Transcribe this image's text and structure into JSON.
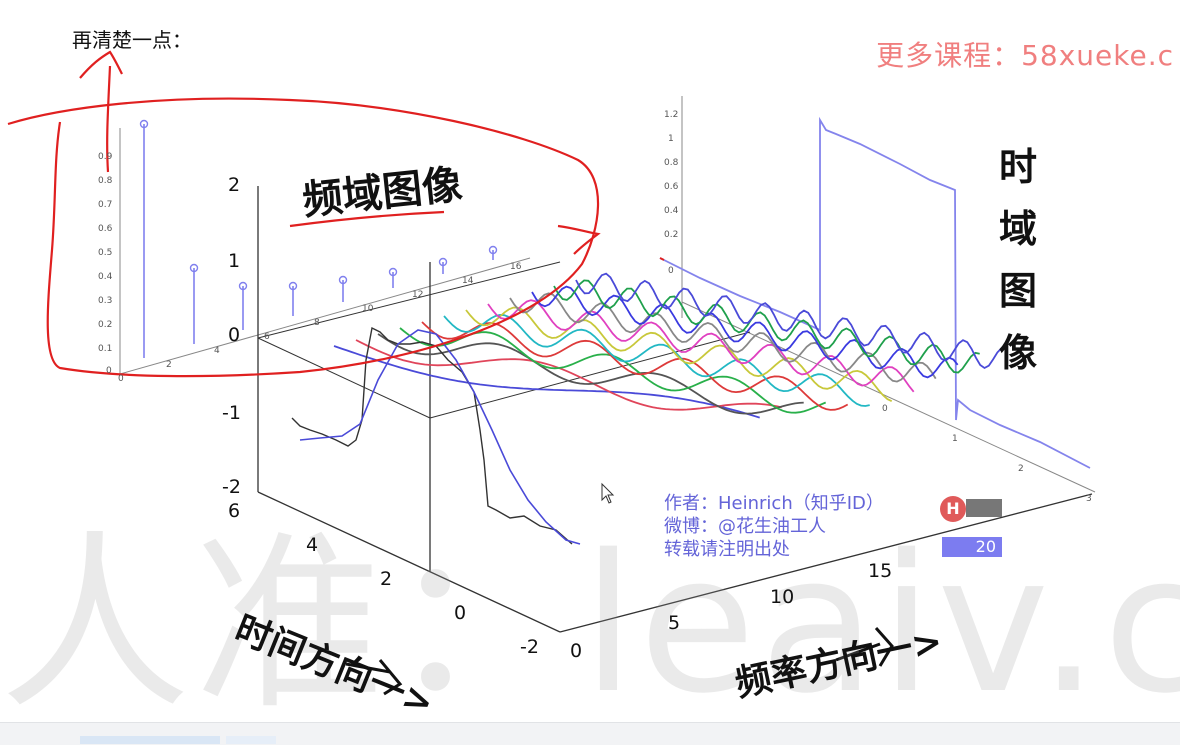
{
  "note": {
    "text": "再清楚一点："
  },
  "watermark": {
    "top_right": "更多课程：58xueke.c",
    "background": "人准：leaiv.cn"
  },
  "labels": {
    "freq_domain": "频域图像",
    "time_domain_chars": [
      "时",
      "域",
      "图",
      "像"
    ],
    "time_direction": "时间方向一>",
    "freq_direction": "频率方向一>"
  },
  "credits": {
    "author": "作者：Heinrich（知乎ID）",
    "weibo": "微博：@花生油工人",
    "repost": "转载请注明出处"
  },
  "controls": {
    "badge": "H",
    "value": "20"
  },
  "axis_ticks": {
    "vertical": [
      "2",
      "1",
      "0",
      "-1",
      "-2"
    ],
    "time": [
      "6",
      "4",
      "2",
      "0",
      "-2"
    ],
    "freq": [
      "0",
      "5",
      "10",
      "15"
    ],
    "time_panel_x": [
      "0",
      "1",
      "2",
      "3"
    ],
    "spectrum_x": [
      "0",
      "2",
      "4",
      "6",
      "8",
      "10",
      "12",
      "14",
      "16"
    ],
    "spectrum_y": [
      "0.9",
      "0.8",
      "0.7",
      "0.6",
      "0.5",
      "0.4",
      "0.3",
      "0.2",
      "0.1",
      "0"
    ],
    "time_panel_y": [
      "1.2",
      "1",
      "0.8",
      "0.6",
      "0.4",
      "0.2",
      "0"
    ]
  },
  "colors": {
    "annotation_red": "#e02020",
    "stem_blue": "#8080ee",
    "credit_blue": "#6464d8",
    "wave_colors": [
      "#4a4ad8",
      "#e0455a",
      "#555555",
      "#29b04a",
      "#dd3a3a",
      "#22b8c4",
      "#c8c83a",
      "#e040c0",
      "#888888",
      "#3a3ae0",
      "#1fa04c",
      "#4a4ad8"
    ]
  }
}
